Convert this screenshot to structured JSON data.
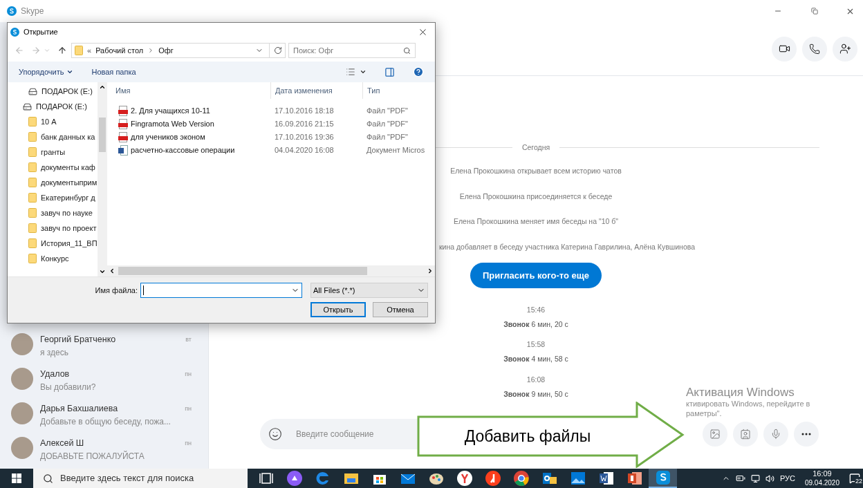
{
  "skype_window": {
    "title": "Skype"
  },
  "chats": [
    {
      "name": "Георгий Братченко",
      "preview": "я здесь",
      "time": "вт"
    },
    {
      "name": "Удалов",
      "preview": "Вы добавили?",
      "time": "пн"
    },
    {
      "name": "Дарья Бахшалиева",
      "preview": "Добавьте в общую беседу, пожа...",
      "time": "пн"
    },
    {
      "name": "Алексей Ш",
      "preview": "ДОБАВЬТЕ ПОЖАЛУЙСТА",
      "time": "пн"
    }
  ],
  "conversation": {
    "date_separator": "Сегодня",
    "events": [
      "Елена Прокошкина открывает всем историю чатов",
      "Елена Прокошкина присоединяется к беседе",
      "Елена Прокошкина меняет имя беседы на \"10 б\"",
      "кина добавляет в беседу участника Катерина Гаврилина, Алёна Кувшинова"
    ],
    "invite_button": "Пригласить кого-то еще",
    "calls": [
      {
        "time": "15:46",
        "summary": "**Звонок** 6 мин, 20 с"
      },
      {
        "time": "15:58",
        "summary": "**Звонок** 4 мин, 58 с"
      },
      {
        "time": "16:08",
        "summary": "**Звонок** 9 мин, 50 с"
      }
    ]
  },
  "composer": {
    "placeholder": "Введите сообщение"
  },
  "dialog": {
    "title": "Открытие",
    "address_prefix": "«",
    "address_parts": [
      "Рабочий стол",
      "Офг"
    ],
    "search_placeholder": "Поиск: Офг",
    "organize": "Упорядочить",
    "new_folder": "Новая папка",
    "nav_tree": [
      {
        "label": "ПОДАРОК (E:)",
        "kind": "drive"
      },
      {
        "label": "ПОДАРОК (E:)",
        "kind": "drive",
        "children": [
          {
            "label": "10 А",
            "kind": "folder"
          },
          {
            "label": "банк данных ка",
            "kind": "folder"
          },
          {
            "label": "гранты",
            "kind": "folder"
          },
          {
            "label": "документы каф",
            "kind": "folder"
          },
          {
            "label": "документыприм",
            "kind": "folder"
          },
          {
            "label": "Екатеринбург д",
            "kind": "folder"
          },
          {
            "label": "завуч по науке",
            "kind": "folder"
          },
          {
            "label": "завуч по проект",
            "kind": "folder"
          },
          {
            "label": "История_11_ВП",
            "kind": "folder"
          },
          {
            "label": "Конкурс",
            "kind": "folder"
          }
        ]
      }
    ],
    "columns": [
      "Имя",
      "Дата изменения",
      "Тип"
    ],
    "files": [
      {
        "name": "2. Для учащихся 10-11",
        "date": "17.10.2016 18:18",
        "type": "Файл \"PDF\"",
        "kind": "pdf"
      },
      {
        "name": "Fingramota Web Version",
        "date": "16.09.2016 21:15",
        "type": "Файл \"PDF\"",
        "kind": "pdf"
      },
      {
        "name": "для учеников эконом",
        "date": "17.10.2016 19:36",
        "type": "Файл \"PDF\"",
        "kind": "pdf"
      },
      {
        "name": "расчетно-кассовые операции",
        "date": "04.04.2020 16:08",
        "type": "Документ Micros",
        "kind": "word"
      }
    ],
    "filename_label": "Имя файла:",
    "filter": "All Files (*.*)",
    "buttons": [
      {
        "label": "Открыть",
        "default": true
      },
      {
        "label": "Отмена",
        "default": false
      }
    ]
  },
  "callout": {
    "text": "Добавить файлы"
  },
  "activation_watermark": {
    "title": "Активация Windows",
    "lines": [
      "ктивировать Windows, перейдите в",
      "раметры\"."
    ]
  },
  "taskbar": {
    "search_placeholder": "Введите здесь текст для поиска",
    "apps": [
      {
        "kind": "taskview",
        "selected": false
      },
      {
        "kind": "assistant",
        "selected": false
      },
      {
        "kind": "edge",
        "selected": false
      },
      {
        "kind": "explorer",
        "selected": false
      },
      {
        "kind": "store",
        "selected": false
      },
      {
        "kind": "mail",
        "selected": false
      },
      {
        "kind": "paint",
        "selected": false
      },
      {
        "kind": "ybrowser",
        "selected": false
      },
      {
        "kind": "yandex",
        "selected": false
      },
      {
        "kind": "chrome",
        "selected": false
      },
      {
        "kind": "outlook",
        "selected": false
      },
      {
        "kind": "photos",
        "selected": false
      },
      {
        "kind": "word",
        "selected": false
      },
      {
        "kind": "powerpoint",
        "selected": false
      },
      {
        "kind": "skype",
        "selected": true
      }
    ],
    "language": "РУС",
    "time": "16:09",
    "date": "09.04.2020",
    "notifications": "22"
  }
}
